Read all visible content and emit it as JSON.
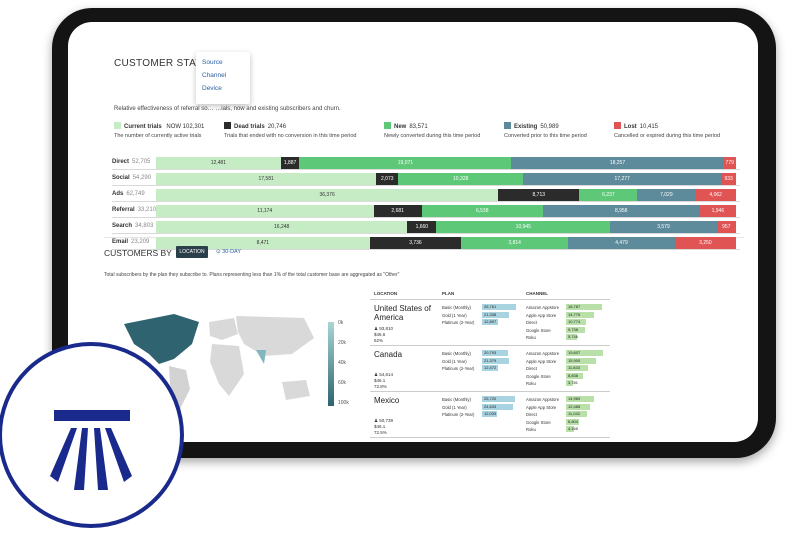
{
  "panel1": {
    "title": "CUSTOMER STATUS PER",
    "dropdown": [
      "Source",
      "Channel",
      "Device"
    ],
    "subtitle": "Relative effectiveness of referral so… …ials, now and existing subscribers and churn."
  },
  "legend": [
    {
      "name": "Current trials",
      "value": "102,301",
      "desc": "The number of currently active trials",
      "color": "#c6ecc6"
    },
    {
      "name": "Dead trials",
      "value": "20,746",
      "desc": "Trials that ended with no conversion in this time period",
      "color": "#2b2b2b"
    },
    {
      "name": "New",
      "value": "83,571",
      "desc": "Newly converted during this time period",
      "color": "#5dc878"
    },
    {
      "name": "Existing",
      "value": "50,989",
      "desc": "Converted prior to this time period",
      "color": "#5d8b9c"
    },
    {
      "name": "Lost",
      "value": "10,415",
      "desc": "Cancelled or expired during this time period",
      "color": "#e05454"
    }
  ],
  "legend_now": "NOW",
  "rows": [
    {
      "label": "Direct",
      "total": "52,705",
      "segs": [
        [
          "trial",
          "12,481",
          20
        ],
        [
          "dead",
          "1,887",
          3
        ],
        [
          "new",
          "19,071",
          34
        ],
        [
          "exist",
          "18,257",
          34
        ],
        [
          "lost",
          "779",
          2
        ]
      ]
    },
    {
      "label": "Social",
      "total": "54,290",
      "segs": [
        [
          "trial",
          "17,581",
          30
        ],
        [
          "dead",
          "2,073",
          3
        ],
        [
          "new",
          "10,328",
          17
        ],
        [
          "exist",
          "17,277",
          27
        ],
        [
          "lost",
          "933",
          2
        ]
      ]
    },
    {
      "label": "Ads",
      "total": "62,749",
      "segs": [
        [
          "trial",
          "36,376",
          59
        ],
        [
          "dead",
          "8,713",
          14
        ],
        [
          "new",
          "6,237",
          10
        ],
        [
          "exist",
          "7,029",
          10
        ],
        [
          "lost",
          "4,062",
          7
        ]
      ]
    },
    {
      "label": "Referral",
      "total": "33,210",
      "segs": [
        [
          "trial",
          "11,174",
          18
        ],
        [
          "dead",
          "2,681",
          4
        ],
        [
          "new",
          "6,538",
          10
        ],
        [
          "exist",
          "8,958",
          13
        ],
        [
          "lost",
          "1,946",
          3
        ]
      ]
    },
    {
      "label": "Search",
      "total": "34,803",
      "segs": [
        [
          "trial",
          "16,248",
          26
        ],
        [
          "dead",
          "1,660",
          3
        ],
        [
          "new",
          "10,945",
          18
        ],
        [
          "exist",
          "3,579",
          11
        ],
        [
          "lost",
          "957",
          2
        ]
      ]
    },
    {
      "label": "Email",
      "total": "23,209",
      "segs": [
        [
          "trial",
          "8,471",
          14
        ],
        [
          "dead",
          "3,736",
          6
        ],
        [
          "new",
          "3,814",
          7
        ],
        [
          "exist",
          "4,479",
          7
        ],
        [
          "lost",
          "3,250",
          4
        ]
      ]
    }
  ],
  "panel2": {
    "title": "CUSTOMERS BY",
    "tab_active": "LOCATION",
    "tab_other": "⊙ 30-DAY",
    "subtitle": "Total subscribers by the plan they subscribe to. Plans representing less than 1% of the total customer base are aggregated as \"Other\"",
    "scale": [
      "0k",
      "20k",
      "40k",
      "60k",
      "100k"
    ],
    "headers": [
      "LOCATION",
      "PLAN",
      "CHANNEL"
    ]
  },
  "countries": [
    {
      "name": "United States of America",
      "customers": "93,810",
      "mrr": "$46.6",
      "pct": "62%",
      "plans": [
        [
          "Basic (Monthly)",
          "26,761"
        ],
        [
          "Gold (1 Year)",
          "21,338"
        ],
        [
          "Platinum (2-Year)",
          "12,897"
        ]
      ],
      "chans": [
        [
          "Amazon Appstore",
          "18,787"
        ],
        [
          "Apple App Store",
          "14,776"
        ],
        [
          "Direct",
          "10,774"
        ],
        [
          "Google Store",
          "9,738"
        ],
        [
          "Roku",
          "5,746"
        ]
      ]
    },
    {
      "name": "Canada",
      "customers": "54,614",
      "mrr": "$46.1",
      "pct": "72.8%",
      "plans": [
        [
          "Basic (Monthly)",
          "20,793"
        ],
        [
          "Gold (1 Year)",
          "21,379"
        ],
        [
          "Platinum (2-Year)",
          "12,472"
        ]
      ],
      "chans": [
        [
          "Amazon Appstore",
          "19,607"
        ],
        [
          "Apple App Store",
          "15,900"
        ],
        [
          "Direct",
          "11,833"
        ],
        [
          "Google Store",
          "8,838"
        ],
        [
          "Roku",
          "3,781"
        ]
      ]
    },
    {
      "name": "Mexico",
      "customers": "50,739",
      "mrr": "$46.1",
      "pct": "72.5%",
      "plans": [
        [
          "Basic (Monthly)",
          "25,720"
        ],
        [
          "Gold (1 Year)",
          "24,633"
        ],
        [
          "Platinum (2-Year)",
          "12,033"
        ]
      ],
      "chans": [
        [
          "Amazon Appstore",
          "14,969"
        ],
        [
          "Apple App Store",
          "12,485"
        ],
        [
          "Direct",
          "11,042"
        ],
        [
          "Google Store",
          "6,804"
        ],
        [
          "Roku",
          "4,165"
        ]
      ]
    }
  ]
}
